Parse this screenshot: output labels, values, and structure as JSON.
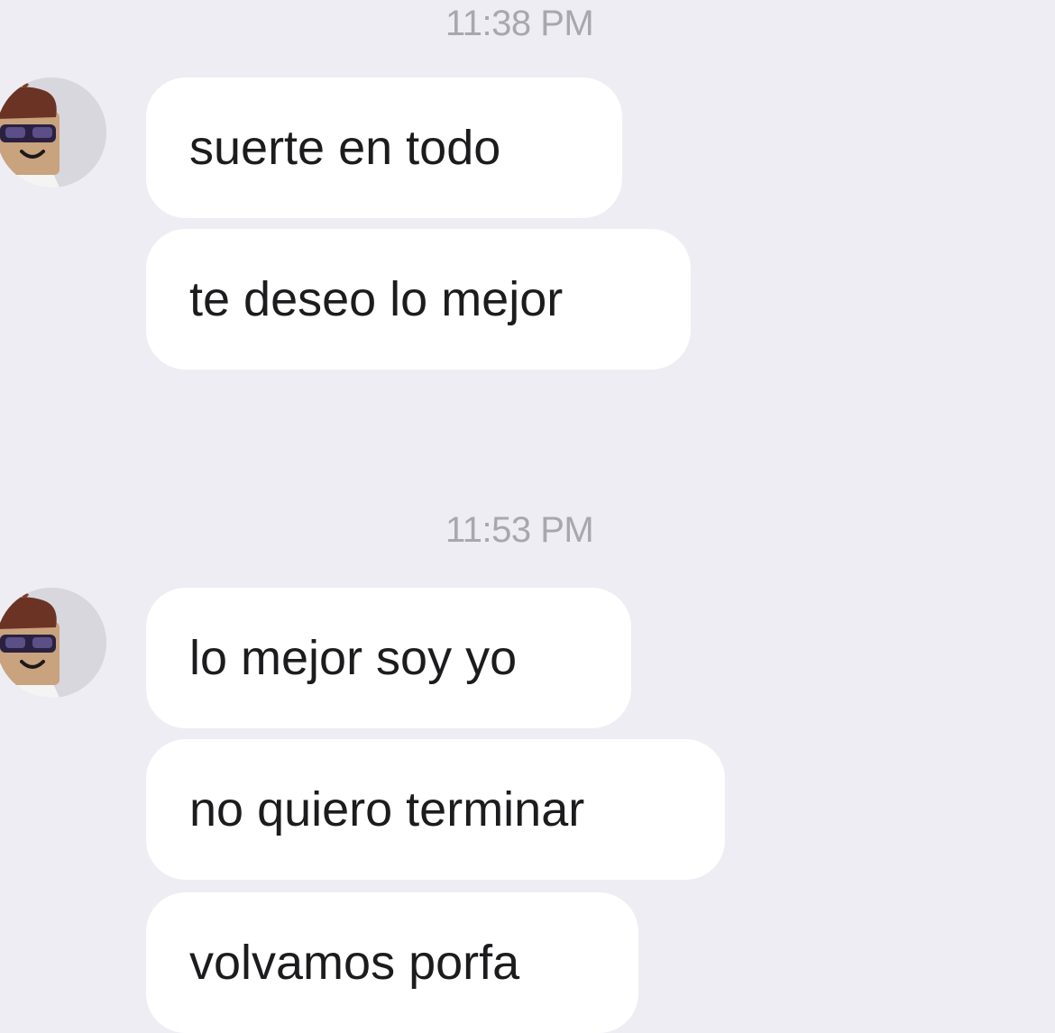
{
  "conversation": {
    "groups": [
      {
        "timestamp": "11:38 PM",
        "messages": [
          {
            "text": "suerte en todo"
          },
          {
            "text": "te deseo lo mejor"
          }
        ]
      },
      {
        "timestamp": "11:53 PM",
        "messages": [
          {
            "text": "lo mejor soy yo"
          },
          {
            "text": "no quiero terminar"
          },
          {
            "text": "volvamos porfa"
          }
        ]
      }
    ]
  },
  "colors": {
    "background": "#eeedf3",
    "bubble": "#ffffff",
    "timestamp_text": "#a8a7ad",
    "message_text": "#1c1c1e"
  },
  "icons": {
    "avatar": "avatar-sunglasses-icon"
  }
}
